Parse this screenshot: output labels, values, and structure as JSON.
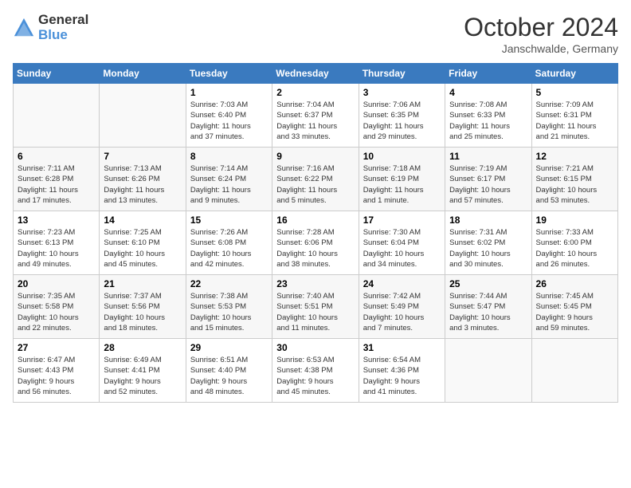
{
  "header": {
    "logo_line1": "General",
    "logo_line2": "Blue",
    "month": "October 2024",
    "location": "Janschwalde, Germany"
  },
  "weekdays": [
    "Sunday",
    "Monday",
    "Tuesday",
    "Wednesday",
    "Thursday",
    "Friday",
    "Saturday"
  ],
  "weeks": [
    [
      {
        "day": "",
        "info": ""
      },
      {
        "day": "",
        "info": ""
      },
      {
        "day": "1",
        "info": "Sunrise: 7:03 AM\nSunset: 6:40 PM\nDaylight: 11 hours\nand 37 minutes."
      },
      {
        "day": "2",
        "info": "Sunrise: 7:04 AM\nSunset: 6:37 PM\nDaylight: 11 hours\nand 33 minutes."
      },
      {
        "day": "3",
        "info": "Sunrise: 7:06 AM\nSunset: 6:35 PM\nDaylight: 11 hours\nand 29 minutes."
      },
      {
        "day": "4",
        "info": "Sunrise: 7:08 AM\nSunset: 6:33 PM\nDaylight: 11 hours\nand 25 minutes."
      },
      {
        "day": "5",
        "info": "Sunrise: 7:09 AM\nSunset: 6:31 PM\nDaylight: 11 hours\nand 21 minutes."
      }
    ],
    [
      {
        "day": "6",
        "info": "Sunrise: 7:11 AM\nSunset: 6:28 PM\nDaylight: 11 hours\nand 17 minutes."
      },
      {
        "day": "7",
        "info": "Sunrise: 7:13 AM\nSunset: 6:26 PM\nDaylight: 11 hours\nand 13 minutes."
      },
      {
        "day": "8",
        "info": "Sunrise: 7:14 AM\nSunset: 6:24 PM\nDaylight: 11 hours\nand 9 minutes."
      },
      {
        "day": "9",
        "info": "Sunrise: 7:16 AM\nSunset: 6:22 PM\nDaylight: 11 hours\nand 5 minutes."
      },
      {
        "day": "10",
        "info": "Sunrise: 7:18 AM\nSunset: 6:19 PM\nDaylight: 11 hours\nand 1 minute."
      },
      {
        "day": "11",
        "info": "Sunrise: 7:19 AM\nSunset: 6:17 PM\nDaylight: 10 hours\nand 57 minutes."
      },
      {
        "day": "12",
        "info": "Sunrise: 7:21 AM\nSunset: 6:15 PM\nDaylight: 10 hours\nand 53 minutes."
      }
    ],
    [
      {
        "day": "13",
        "info": "Sunrise: 7:23 AM\nSunset: 6:13 PM\nDaylight: 10 hours\nand 49 minutes."
      },
      {
        "day": "14",
        "info": "Sunrise: 7:25 AM\nSunset: 6:10 PM\nDaylight: 10 hours\nand 45 minutes."
      },
      {
        "day": "15",
        "info": "Sunrise: 7:26 AM\nSunset: 6:08 PM\nDaylight: 10 hours\nand 42 minutes."
      },
      {
        "day": "16",
        "info": "Sunrise: 7:28 AM\nSunset: 6:06 PM\nDaylight: 10 hours\nand 38 minutes."
      },
      {
        "day": "17",
        "info": "Sunrise: 7:30 AM\nSunset: 6:04 PM\nDaylight: 10 hours\nand 34 minutes."
      },
      {
        "day": "18",
        "info": "Sunrise: 7:31 AM\nSunset: 6:02 PM\nDaylight: 10 hours\nand 30 minutes."
      },
      {
        "day": "19",
        "info": "Sunrise: 7:33 AM\nSunset: 6:00 PM\nDaylight: 10 hours\nand 26 minutes."
      }
    ],
    [
      {
        "day": "20",
        "info": "Sunrise: 7:35 AM\nSunset: 5:58 PM\nDaylight: 10 hours\nand 22 minutes."
      },
      {
        "day": "21",
        "info": "Sunrise: 7:37 AM\nSunset: 5:56 PM\nDaylight: 10 hours\nand 18 minutes."
      },
      {
        "day": "22",
        "info": "Sunrise: 7:38 AM\nSunset: 5:53 PM\nDaylight: 10 hours\nand 15 minutes."
      },
      {
        "day": "23",
        "info": "Sunrise: 7:40 AM\nSunset: 5:51 PM\nDaylight: 10 hours\nand 11 minutes."
      },
      {
        "day": "24",
        "info": "Sunrise: 7:42 AM\nSunset: 5:49 PM\nDaylight: 10 hours\nand 7 minutes."
      },
      {
        "day": "25",
        "info": "Sunrise: 7:44 AM\nSunset: 5:47 PM\nDaylight: 10 hours\nand 3 minutes."
      },
      {
        "day": "26",
        "info": "Sunrise: 7:45 AM\nSunset: 5:45 PM\nDaylight: 9 hours\nand 59 minutes."
      }
    ],
    [
      {
        "day": "27",
        "info": "Sunrise: 6:47 AM\nSunset: 4:43 PM\nDaylight: 9 hours\nand 56 minutes."
      },
      {
        "day": "28",
        "info": "Sunrise: 6:49 AM\nSunset: 4:41 PM\nDaylight: 9 hours\nand 52 minutes."
      },
      {
        "day": "29",
        "info": "Sunrise: 6:51 AM\nSunset: 4:40 PM\nDaylight: 9 hours\nand 48 minutes."
      },
      {
        "day": "30",
        "info": "Sunrise: 6:53 AM\nSunset: 4:38 PM\nDaylight: 9 hours\nand 45 minutes."
      },
      {
        "day": "31",
        "info": "Sunrise: 6:54 AM\nSunset: 4:36 PM\nDaylight: 9 hours\nand 41 minutes."
      },
      {
        "day": "",
        "info": ""
      },
      {
        "day": "",
        "info": ""
      }
    ]
  ]
}
